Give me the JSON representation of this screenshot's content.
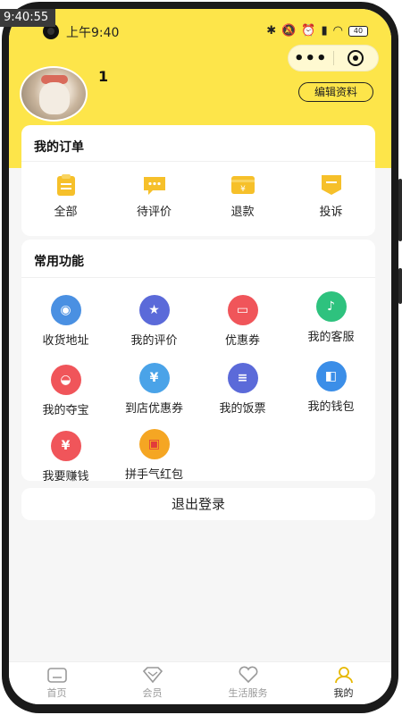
{
  "recording_badge": "9:40:55",
  "status_bar": {
    "time": "上午9:40",
    "battery": "40"
  },
  "profile": {
    "username": "1",
    "edit_label": "编辑资料"
  },
  "orders": {
    "title": "我的订单",
    "items": [
      {
        "label": "全部",
        "icon": "clipboard-icon"
      },
      {
        "label": "待评价",
        "icon": "chat-bubble-icon"
      },
      {
        "label": "退款",
        "icon": "refund-card-icon"
      },
      {
        "label": "投诉",
        "icon": "complaint-icon"
      }
    ]
  },
  "functions": {
    "title": "常用功能",
    "items": [
      {
        "label": "收货地址",
        "icon": "location-icon",
        "color": "#4a90e2"
      },
      {
        "label": "我的评价",
        "icon": "star-icon",
        "color": "#5b6ad9"
      },
      {
        "label": "优惠券",
        "icon": "wallet-icon",
        "color": "#f0555a"
      },
      {
        "label": "我的客服",
        "icon": "bell-icon",
        "color": "#2ec27e"
      },
      {
        "label": "我的夺宝",
        "icon": "treasure-icon",
        "color": "#f0555a"
      },
      {
        "label": "到店优惠券",
        "icon": "store-coupon-icon",
        "color": "#4aa3e8"
      },
      {
        "label": "我的饭票",
        "icon": "ticket-icon",
        "color": "#5b6ad9"
      },
      {
        "label": "我的钱包",
        "icon": "purse-icon",
        "color": "#3b8ee8"
      },
      {
        "label": "我要赚钱",
        "icon": "earn-money-icon",
        "color": "#f0555a"
      },
      {
        "label": "拼手气红包",
        "icon": "red-packet-icon",
        "color": "#f5a623"
      }
    ]
  },
  "logout_label": "退出登录",
  "tabbar": {
    "items": [
      {
        "label": "首页",
        "icon": "home-icon",
        "active": false
      },
      {
        "label": "会员",
        "icon": "diamond-icon",
        "active": false
      },
      {
        "label": "生活服务",
        "icon": "heart-icon",
        "active": false
      },
      {
        "label": "我的",
        "icon": "user-icon",
        "active": true
      }
    ]
  },
  "colors": {
    "accent_yellow": "#fde54a",
    "icon_yellow": "#f6c02a",
    "tab_active": "#e6b800",
    "tab_inactive": "#999999"
  }
}
